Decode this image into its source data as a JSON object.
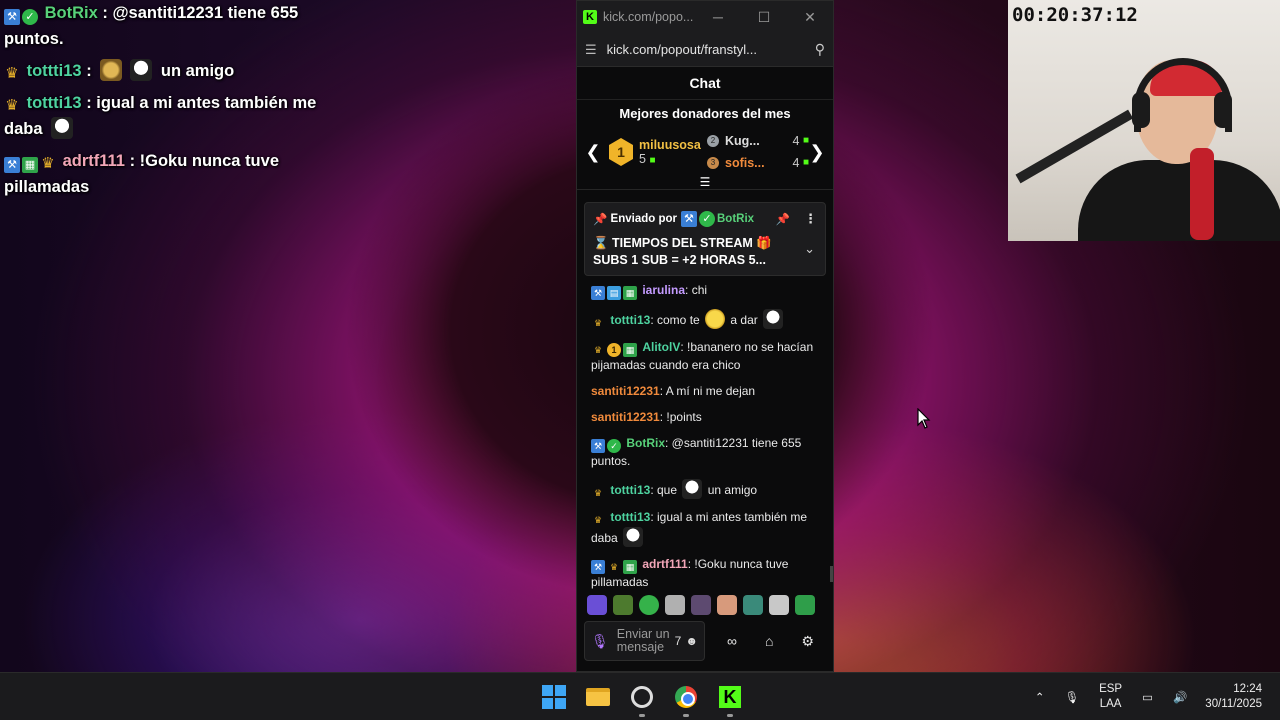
{
  "overlay_chat": {
    "line1": {
      "user": "BotRix",
      "text": ": @santiti12231 tiene 655 puntos."
    },
    "line2": {
      "user": "tottti13",
      "sep": ":",
      "text": "un amigo"
    },
    "line3": {
      "user": "tottti13",
      "text": ": igual a mi antes también me daba"
    },
    "line4": {
      "user": "adrtf111",
      "text": ": !Goku nunca tuve pillamadas"
    }
  },
  "window": {
    "title": "kick.com/popo...",
    "url": "kick.com/popout/franstyl...",
    "minimize": "─",
    "maximize": "☐",
    "close": "✕"
  },
  "chat": {
    "header": "Chat",
    "donors_title": "Mejores donadores del mes",
    "top_donor": {
      "rank": "1",
      "name": "miluusosa",
      "count": "5"
    },
    "donor2": {
      "name": "Kug...",
      "count": "4"
    },
    "donor3": {
      "name": "sofis...",
      "count": "4"
    },
    "pinned": {
      "sent_by": "Enviado por",
      "user": "BotRix",
      "message": "⌛ TIEMPOS DEL STREAM 🎁 SUBS 1 SUB = +2 HORAS 5..."
    },
    "messages": [
      {
        "user": "iarulina",
        "text": ": chi"
      },
      {
        "user": "tottti13",
        "text": ": como te",
        "text2": "a dar"
      },
      {
        "user": "AlitolV",
        "text": ": !bananero no se hacían pijamadas cuando era chico"
      },
      {
        "user": "santiti12231",
        "text": ": A mí ni me dejan"
      },
      {
        "user": "santiti12231",
        "text": ": !points"
      },
      {
        "user": "BotRix",
        "text": ": @santiti12231 tiene 655 puntos."
      },
      {
        "user": "tottti13",
        "text": ": que",
        "text2": "un amigo"
      },
      {
        "user": "tottti13",
        "text": ": igual a mi antes también me daba"
      },
      {
        "user": "adrtf111",
        "text": ": !Goku nunca tuve pillamadas"
      }
    ],
    "input_placeholder": "Enviar un mensaje"
  },
  "stream": {
    "timer": "00:20:37:12"
  },
  "taskbar": {
    "lang_top": "ESP",
    "lang_bottom": "LAA",
    "time": "12:24",
    "date": "30/11/2025"
  },
  "colors": {
    "kick_green": "#53fc18",
    "donor_gold": "#f2c044",
    "bot_green": "#58d17a"
  }
}
